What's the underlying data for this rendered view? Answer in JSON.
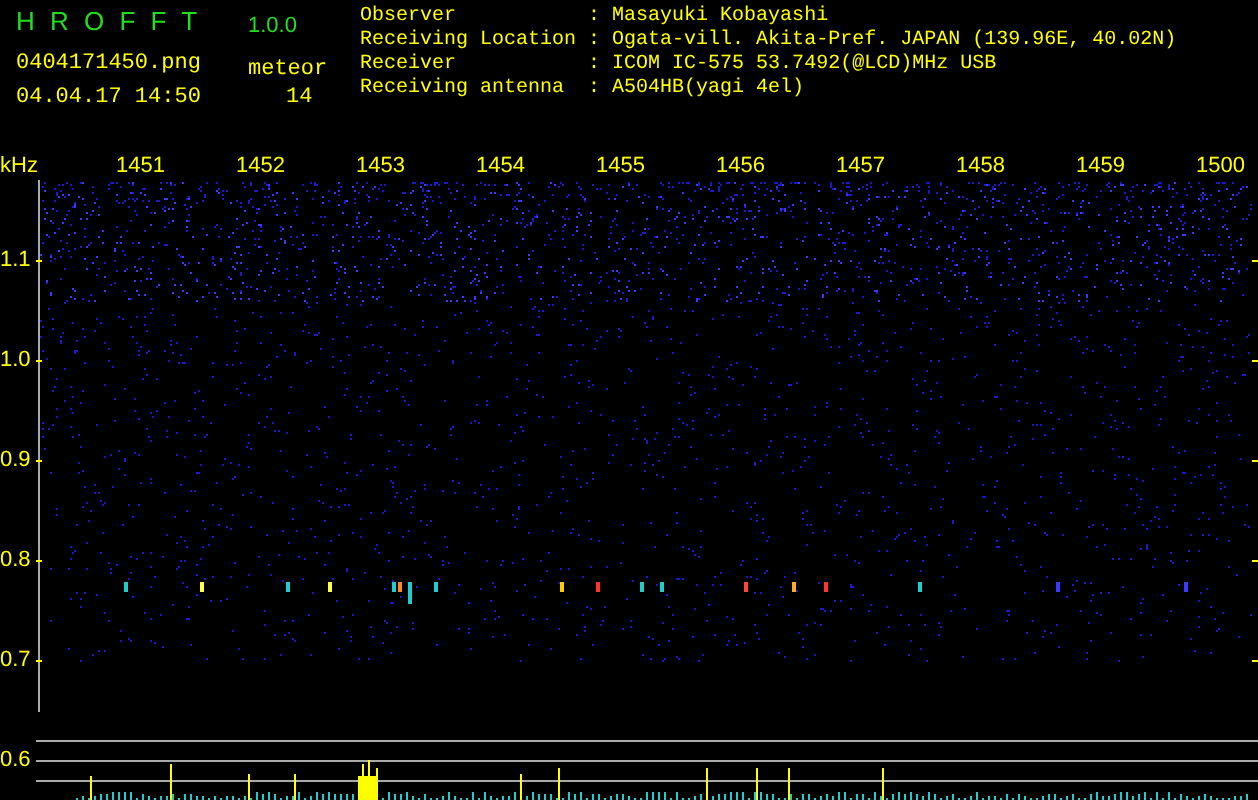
{
  "app": {
    "name": "H R O F F T",
    "version": "1.0.0",
    "file": "0404171450.png",
    "date_time": "04.04.17 14:50",
    "count_label": "meteor",
    "count": "14"
  },
  "station": [
    {
      "label": "Observer",
      "separator": ":",
      "value": "Masayuki Kobayashi"
    },
    {
      "label": "Receiving Location",
      "separator": ":",
      "value": "Ogata-vill. Akita-Pref. JAPAN (139.96E, 40.02N)"
    },
    {
      "label": "Receiver",
      "separator": ":",
      "value": "ICOM IC-575 53.7492(@LCD)MHz USB"
    },
    {
      "label": "Receiving antenna",
      "separator": ":",
      "value": "A504HB(yagi 4el)"
    }
  ],
  "plot": {
    "unit": "kHz",
    "frequency_labels": [
      "1451",
      "1452",
      "1453",
      "1454",
      "1455",
      "1456",
      "1457",
      "1458",
      "1459",
      "1500"
    ],
    "level_labels": [
      "1.1",
      "1.0",
      "0.9",
      "0.8",
      "0.7",
      "0.6"
    ]
  }
}
